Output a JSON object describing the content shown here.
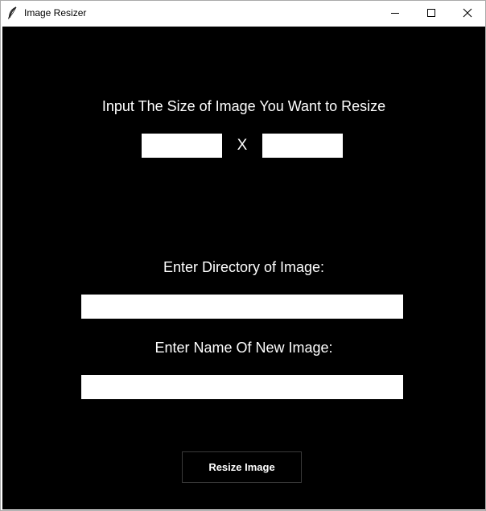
{
  "window": {
    "title": "Image Resizer",
    "controls": [
      "minimize-icon",
      "maximize-icon",
      "close-icon"
    ]
  },
  "form": {
    "size_label": "Input The Size of Image You Want to Resize",
    "width_value": "",
    "height_value": "",
    "times_symbol": "X",
    "directory_label": "Enter Directory of Image:",
    "directory_value": "",
    "name_label": "Enter Name Of New Image:",
    "name_value": "",
    "resize_button_label": "Resize Image"
  },
  "colors": {
    "background": "#000000",
    "text": "#ffffff",
    "field": "#ffffff"
  }
}
